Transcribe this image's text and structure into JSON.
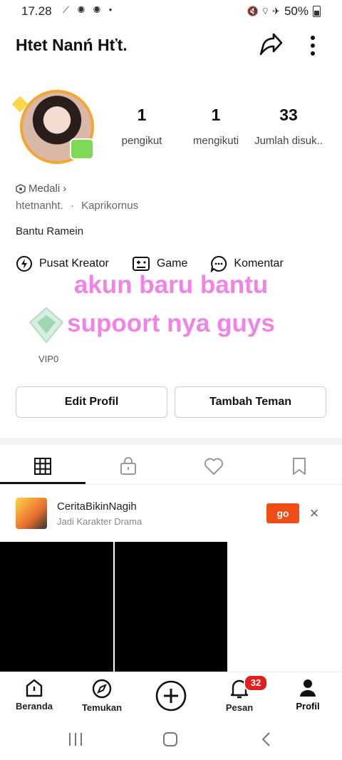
{
  "status_bar": {
    "time": "17.28",
    "battery": "50%",
    "left_icons": "⟋ ◉ ◉ •",
    "right_icons": "🔇 ⌔ ✈"
  },
  "header": {
    "username": "Htet Nanń Hťt."
  },
  "stats": [
    {
      "value": "1",
      "label": "pengikut"
    },
    {
      "value": "1",
      "label": "mengikuti"
    },
    {
      "value": "33",
      "label": "Jumlah disuk.."
    }
  ],
  "profile": {
    "medal_label": "Medali",
    "medal_chevron": "›",
    "handle": "htetnanht.",
    "separator": "·",
    "zodiac": "Kaprikornus",
    "bio": "Bantu Ramein"
  },
  "shortcuts": [
    {
      "label": "Pusat Kreator",
      "icon": "lightning-circle-icon"
    },
    {
      "label": "Game",
      "icon": "gamepad-icon"
    },
    {
      "label": "Komentar",
      "icon": "comment-icon"
    }
  ],
  "overlay_text": {
    "line1": "akun baru bantu",
    "line2": "supoort nya guys"
  },
  "vip": {
    "label": "VIP0"
  },
  "buttons": {
    "edit_profile": "Edit Profil",
    "add_friend": "Tambah Teman"
  },
  "tabs": [
    {
      "name": "grid",
      "icon": "grid-icon"
    },
    {
      "name": "private",
      "icon": "lock-bag-icon"
    },
    {
      "name": "liked",
      "icon": "heart-icon"
    },
    {
      "name": "saved",
      "icon": "bookmark-icon"
    }
  ],
  "ad": {
    "title": "CeritaBikinNagih",
    "subtitle": "Jadi Karakter Drama",
    "cta": "go",
    "close": "×"
  },
  "bottom_nav": [
    {
      "label": "Beranda",
      "icon": "home-icon"
    },
    {
      "label": "Temukan",
      "icon": "compass-icon"
    },
    {
      "label": "",
      "icon": "create-plus-icon"
    },
    {
      "label": "Pesan",
      "icon": "bell-icon",
      "badge": "32"
    },
    {
      "label": "Profil",
      "icon": "person-icon"
    }
  ],
  "colors": {
    "accent_orange": "#f04e16",
    "badge_red": "#e02020",
    "overlay_pink": "#ef84e6"
  }
}
